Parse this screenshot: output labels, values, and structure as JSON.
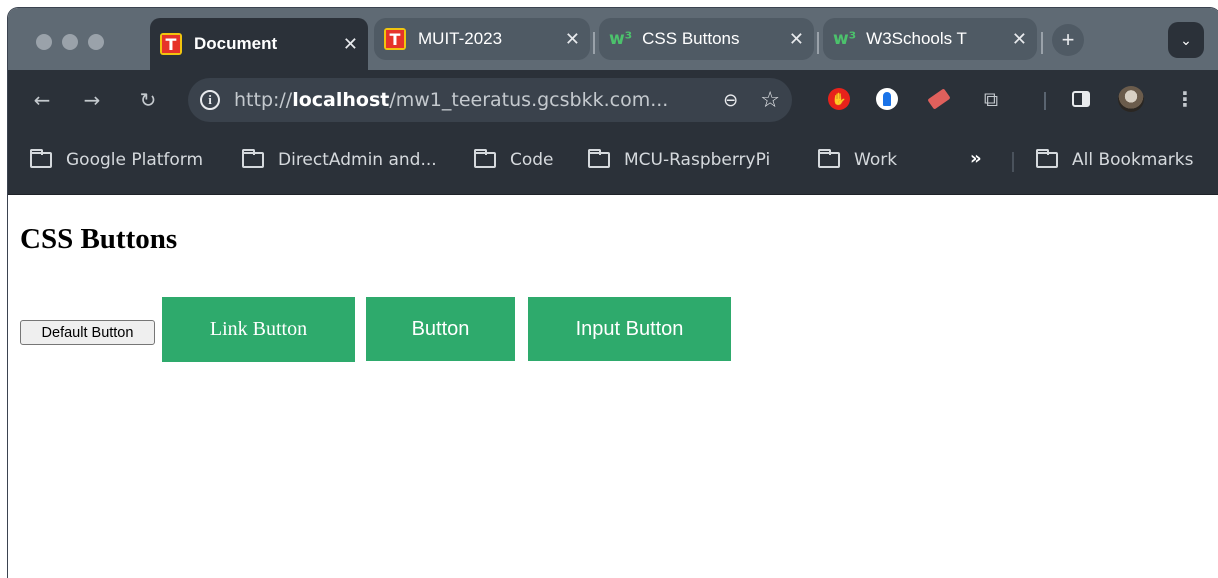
{
  "tabs": [
    {
      "label": "Document",
      "favicon": "t-icon",
      "active": true
    },
    {
      "label": "MUIT-2023",
      "favicon": "t-icon",
      "active": false
    },
    {
      "label": "CSS Buttons",
      "favicon": "w3schools-icon",
      "active": false
    },
    {
      "label": "W3Schools T",
      "favicon": "w3schools-icon",
      "active": false
    }
  ],
  "toolbar": {
    "url_prefix": "http://",
    "url_host": "localhost",
    "url_rest": "/mw1_teeratus.gcsbkk.com..."
  },
  "bookmarks": [
    {
      "label": "Google Platform"
    },
    {
      "label": "DirectAdmin and..."
    },
    {
      "label": "Code"
    },
    {
      "label": "MCU-RaspberryPi"
    },
    {
      "label": "Work"
    }
  ],
  "bookmarks_more": "All Bookmarks",
  "page": {
    "heading": "CSS Buttons",
    "default_button": "Default Button",
    "link_button": "Link Button",
    "button": "Button",
    "input_button": "Input Button"
  },
  "colors": {
    "accent_green": "#2eaa6c",
    "toolbar_bg": "#2b3139",
    "tabstrip_bg": "#5f6a74"
  }
}
